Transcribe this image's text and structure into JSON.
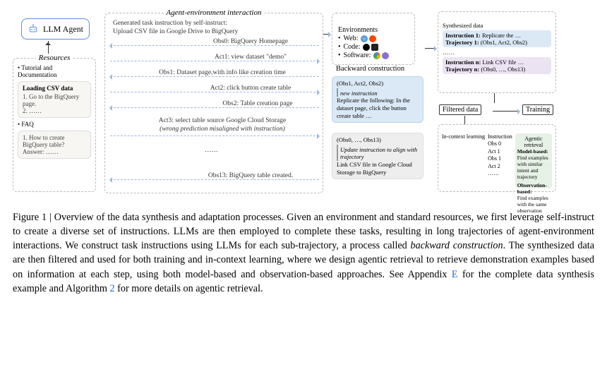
{
  "agent": {
    "label": "LLM Agent"
  },
  "resources": {
    "title": "Resources",
    "item1": "Tutorial and Documentation",
    "loading": "Loading CSV data",
    "step1": "1. Go to the BigQuery page.",
    "step2": "2. ……",
    "item2": "FAQ",
    "faq1": "1. How to create BigQuery table?",
    "faqA": "Answer: ……"
  },
  "interaction": {
    "title": "Agent-environment interaction",
    "gen1": "Generated task instruction by self-instruct:",
    "gen2": "Upload CSV file in Google Drive to BigQuery",
    "obs0": "Obs0: BigQuery Homepage",
    "act1": "Act1: view dataset \"demo\"",
    "obs1": "Obs1: Dataset page,with info like creation time",
    "act2": "Act2: click button create table",
    "obs2": "Obs2: Table creation page",
    "act3a": "Act3: select table source Google Cloud Storage",
    "act3b": "(wrong prediction misaligned with instruction)",
    "dots": "……",
    "obs13": "Obs13: BigQuery table created."
  },
  "env": {
    "title": "Environments",
    "web": "Web:",
    "code": "Code:",
    "soft": "Software:"
  },
  "backward": {
    "label": "Backward construction",
    "c1traj": "(Obs1, Act2, Obs2)",
    "c1new": "new instruction",
    "c1body": "Replicate the following: In the dataset page, click the button create table …",
    "c2traj": "(Obs0, …, Obs13)",
    "c2new": "Update instruction to align with trajectory",
    "c2body": "Link CSV file in Google Cloud Storage to BigQuery"
  },
  "synth": {
    "title": "Synthesized data",
    "i1a": "Instruction 1:",
    "i1b": "Replicate the …",
    "t1a": "Trajectory 1:",
    "t1b": "(Obs1, Act2, Obs2)",
    "dots": "……",
    "ina": "Instruction n:",
    "inb": "Link CSV file …",
    "tna": "Trajectory n:",
    "tnb": "(Obs0, …, Obs13)"
  },
  "flow": {
    "filtered": "Filtered data",
    "training": "Training"
  },
  "icl": {
    "title": "In-context learning",
    "colL": "Instruction",
    "colR": "Agentic retrieval",
    "l1": "Obs 0",
    "l2": "Act 1",
    "l3": "Obs 1",
    "l4": "Act 2",
    "l5": "……",
    "r1t": "Model-based:",
    "r1b": "Find examples with similar intent and trajectory",
    "r2t": "Observation-based:",
    "r2b": "Find examples with the same observation"
  },
  "caption": {
    "lead": "Figure 1 | Overview of the data synthesis and adaptation processes.",
    "body1": " Given an environment and standard resources, we first leverage self-instruct to create a diverse set of instructions. LLMs are then employed to complete these tasks, resulting in long trajectories of agent-environment interactions. We construct task instructions using LLMs for each sub-trajectory, a process called ",
    "bwd": "backward construction",
    "body2": ". The synthesized data are then filtered and used for both training and in-context learning, where we design agentic retrieval to retrieve demonstration examples based on information at each step, using both model-based and observation-based approaches. See Appendix ",
    "linkE": "E",
    "body3": " for the complete data synthesis example and Algorithm ",
    "link2": "2",
    "body4": " for more details on agentic retrieval."
  }
}
